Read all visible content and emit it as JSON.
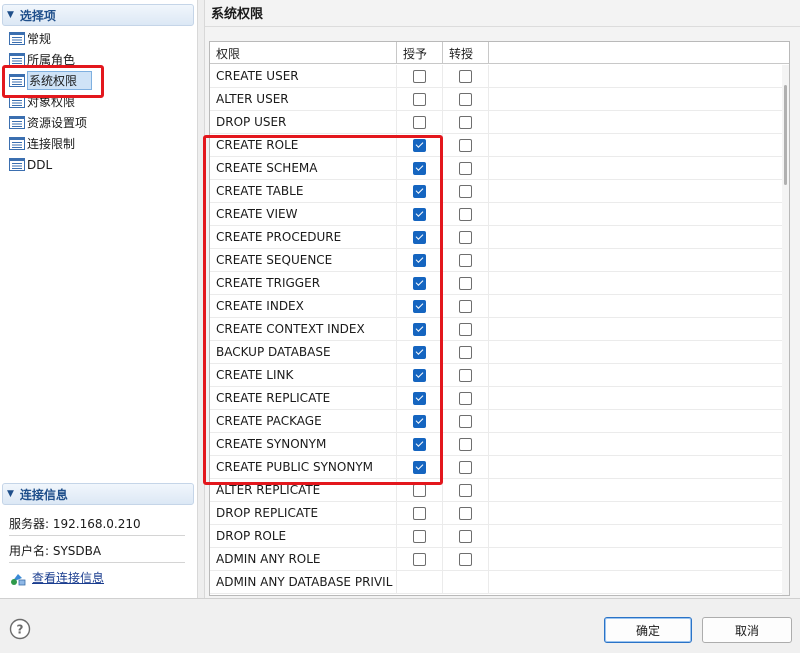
{
  "left_panel": {
    "options_header": "选择项",
    "nav_items": [
      {
        "label": "常规",
        "selected": false
      },
      {
        "label": "所属角色",
        "selected": false
      },
      {
        "label": "系统权限",
        "selected": true
      },
      {
        "label": "对象权限",
        "selected": false
      },
      {
        "label": "资源设置项",
        "selected": false
      },
      {
        "label": "连接限制",
        "selected": false
      },
      {
        "label": "DDL",
        "selected": false
      }
    ],
    "connection_header": "连接信息",
    "server": "服务器: 192.168.0.210",
    "username": "用户名: SYSDBA",
    "view_connection_link": "查看连接信息"
  },
  "main": {
    "title": "系统权限",
    "columns": {
      "privilege": "权限",
      "grant": "授予",
      "transfer": "转授"
    },
    "rows": [
      {
        "name": "CREATE USER",
        "grant": false,
        "transfer": false
      },
      {
        "name": "ALTER USER",
        "grant": false,
        "transfer": false
      },
      {
        "name": "DROP USER",
        "grant": false,
        "transfer": false
      },
      {
        "name": "CREATE ROLE",
        "grant": true,
        "transfer": false
      },
      {
        "name": "CREATE SCHEMA",
        "grant": true,
        "transfer": false
      },
      {
        "name": "CREATE TABLE",
        "grant": true,
        "transfer": false
      },
      {
        "name": "CREATE VIEW",
        "grant": true,
        "transfer": false
      },
      {
        "name": "CREATE PROCEDURE",
        "grant": true,
        "transfer": false
      },
      {
        "name": "CREATE SEQUENCE",
        "grant": true,
        "transfer": false
      },
      {
        "name": "CREATE TRIGGER",
        "grant": true,
        "transfer": false
      },
      {
        "name": "CREATE INDEX",
        "grant": true,
        "transfer": false
      },
      {
        "name": "CREATE CONTEXT INDEX",
        "grant": true,
        "transfer": false
      },
      {
        "name": "BACKUP DATABASE",
        "grant": true,
        "transfer": false
      },
      {
        "name": "CREATE LINK",
        "grant": true,
        "transfer": false
      },
      {
        "name": "CREATE REPLICATE",
        "grant": true,
        "transfer": false
      },
      {
        "name": "CREATE PACKAGE",
        "grant": true,
        "transfer": false
      },
      {
        "name": "CREATE SYNONYM",
        "grant": true,
        "transfer": false
      },
      {
        "name": "CREATE PUBLIC SYNONYM",
        "grant": true,
        "transfer": false
      },
      {
        "name": "ALTER REPLICATE",
        "grant": false,
        "transfer": false
      },
      {
        "name": "DROP REPLICATE",
        "grant": false,
        "transfer": false
      },
      {
        "name": "DROP ROLE",
        "grant": false,
        "transfer": false
      },
      {
        "name": "ADMIN ANY ROLE",
        "grant": false,
        "transfer": false
      },
      {
        "name": "ADMIN ANY DATABASE PRIVIL",
        "grant": null,
        "transfer": null
      }
    ]
  },
  "buttons": {
    "ok": "确定",
    "cancel": "取消"
  },
  "colors": {
    "accent": "#1565c0",
    "highlight_box": "#e3171d",
    "header_text": "#1f4f8b"
  }
}
